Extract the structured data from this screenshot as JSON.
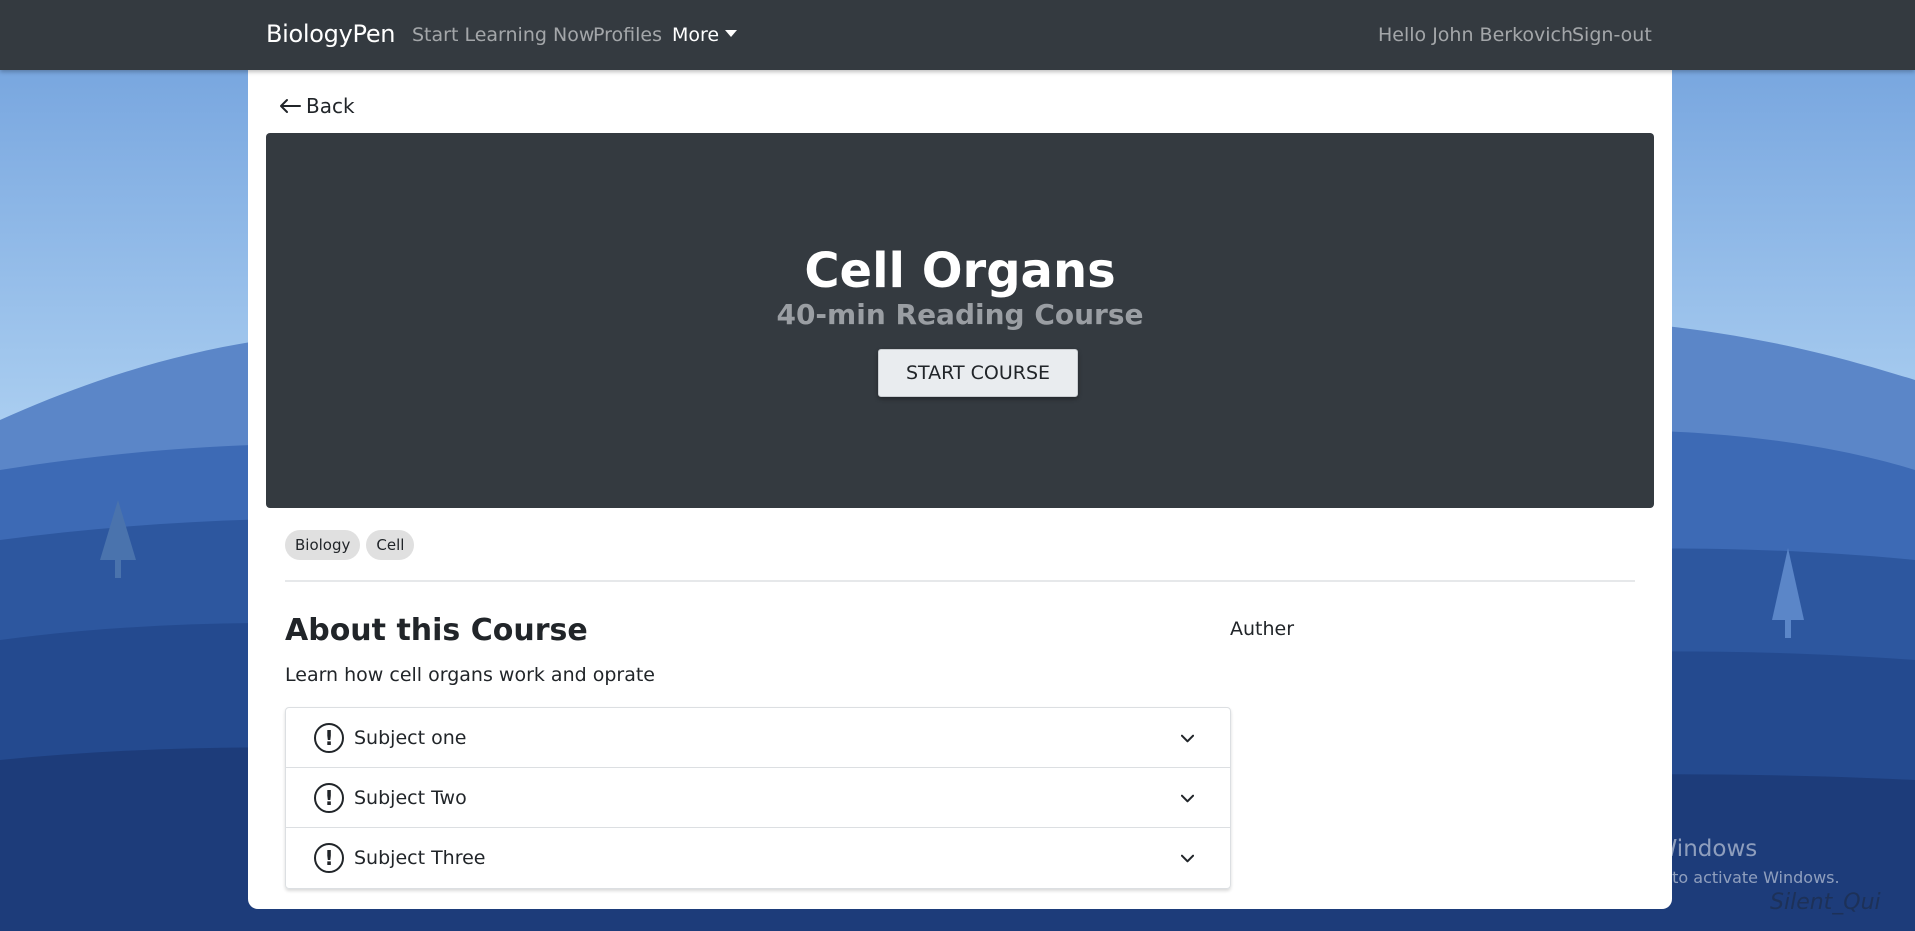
{
  "navbar": {
    "brand": "BiologyPen",
    "links": [
      {
        "label": "Start Learning Now"
      },
      {
        "label": "Profiles"
      },
      {
        "label": "More"
      }
    ],
    "greeting": "Hello John Berkovich",
    "signout": "Sign-out"
  },
  "page": {
    "back_label": "Back",
    "hero": {
      "title": "Cell Organs",
      "subtitle": "40-min Reading Course",
      "start_button": "START COURSE"
    },
    "tags": [
      "Biology",
      "Cell"
    ],
    "about": {
      "title": "About this Course",
      "description": "Learn how cell organs work and oprate",
      "author_label": "Auther"
    },
    "subjects": [
      {
        "label": "Subject one",
        "icon": "exclamation-circle-icon"
      },
      {
        "label": "Subject Two",
        "icon": "exclamation-circle-icon"
      },
      {
        "label": "Subject Three",
        "icon": "exclamation-circle-icon"
      }
    ]
  },
  "watermark": {
    "title": "Activate Windows",
    "subtitle": "Go to Settings to activate Windows.",
    "corner_text": "Silent_Qui"
  },
  "colors": {
    "navbar": "#343a40",
    "hero": "#343a40",
    "card": "#ffffff",
    "sky_top": "#8fb8e8",
    "hills_dark": "#1f3f86"
  }
}
